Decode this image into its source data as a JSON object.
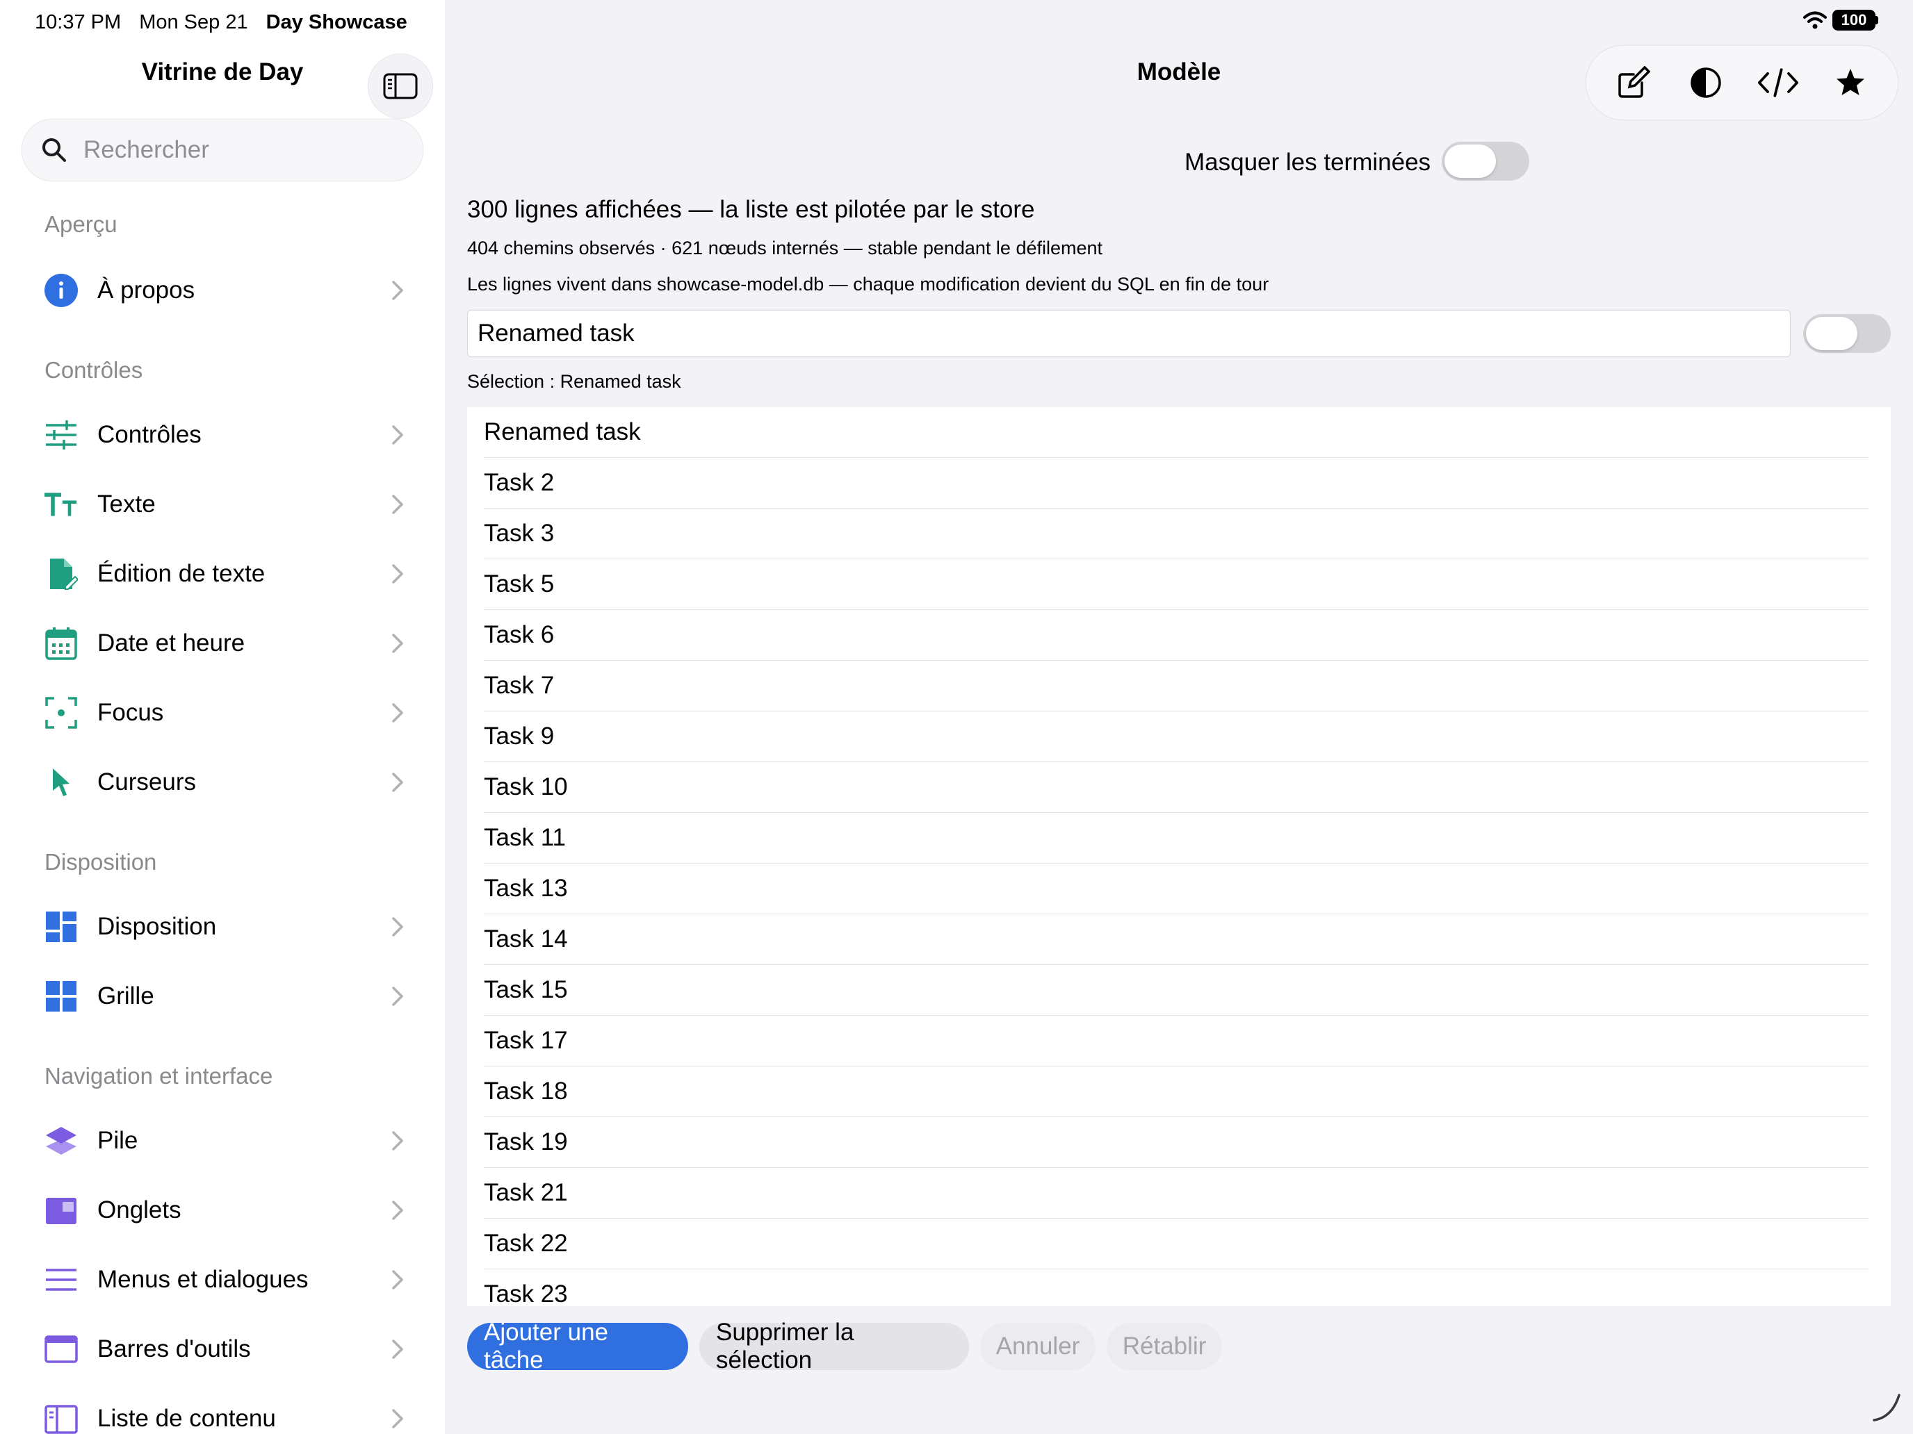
{
  "status": {
    "time": "10:37 PM",
    "date": "Mon Sep 21",
    "app_name": "Day Showcase",
    "battery": "100",
    "wifi_icon": "wifi-icon"
  },
  "sidebar": {
    "title": "Vitrine de Day",
    "toggle_icon": "sidebar-toggle-icon",
    "search_placeholder": "Rechercher",
    "sections": {
      "apercu": "Aperçu",
      "controles": "Contrôles",
      "disposition": "Disposition",
      "navigation": "Navigation et interface"
    },
    "items": [
      {
        "label": "À propos",
        "icon": "info-icon",
        "color": "#2f6fe0"
      },
      {
        "label": "Contrôles",
        "icon": "sliders-icon",
        "color": "#1f9e80"
      },
      {
        "label": "Texte",
        "icon": "text-size-icon",
        "color": "#1f9e80"
      },
      {
        "label": "Édition de texte",
        "icon": "document-edit-icon",
        "color": "#1f9e80"
      },
      {
        "label": "Date et heure",
        "icon": "calendar-icon",
        "color": "#1f9e80"
      },
      {
        "label": "Focus",
        "icon": "focus-icon",
        "color": "#1f9e80"
      },
      {
        "label": "Curseurs",
        "icon": "cursor-icon",
        "color": "#1f9e80"
      },
      {
        "label": "Disposition",
        "icon": "layout-icon",
        "color": "#2f6fe0"
      },
      {
        "label": "Grille",
        "icon": "grid-icon",
        "color": "#2f6fe0"
      },
      {
        "label": "Pile",
        "icon": "stack-icon",
        "color": "#7b5ce0"
      },
      {
        "label": "Onglets",
        "icon": "tabs-icon",
        "color": "#7b5ce0"
      },
      {
        "label": "Menus et dialogues",
        "icon": "menu-lines-icon",
        "color": "#7b5ce0"
      },
      {
        "label": "Barres d'outils",
        "icon": "toolbar-icon",
        "color": "#7b5ce0"
      },
      {
        "label": "Liste de contenu",
        "icon": "content-list-icon",
        "color": "#7b5ce0"
      }
    ]
  },
  "main": {
    "title": "Modèle",
    "toolbar_icons": [
      "compose-icon",
      "contrast-icon",
      "code-icon",
      "star-icon"
    ],
    "hide_completed_label": "Masquer les terminées",
    "hide_completed_on": false,
    "summary": "300 lignes affichées — la liste est pilotée par le store",
    "stats": "404 chemins observés · 621 nœuds internés — stable pendant le défilement",
    "storage_note": "Les lignes vivent dans showcase-model.db — chaque modification devient du SQL en fin de tour",
    "edit_field_value": "Renamed task",
    "edit_toggle_on": false,
    "selection": "Sélection : Renamed task",
    "tasks": [
      "Renamed task",
      "Task 2",
      "Task 3",
      "Task 5",
      "Task 6",
      "Task 7",
      "Task 9",
      "Task 10",
      "Task 11",
      "Task 13",
      "Task 14",
      "Task 15",
      "Task 17",
      "Task 18",
      "Task 19",
      "Task 21",
      "Task 22",
      "Task 23"
    ],
    "buttons": {
      "add": "Ajouter une tâche",
      "delete": "Supprimer la sélection",
      "undo": "Annuler",
      "redo": "Rétablir"
    },
    "accent": "#2f6fe0"
  }
}
